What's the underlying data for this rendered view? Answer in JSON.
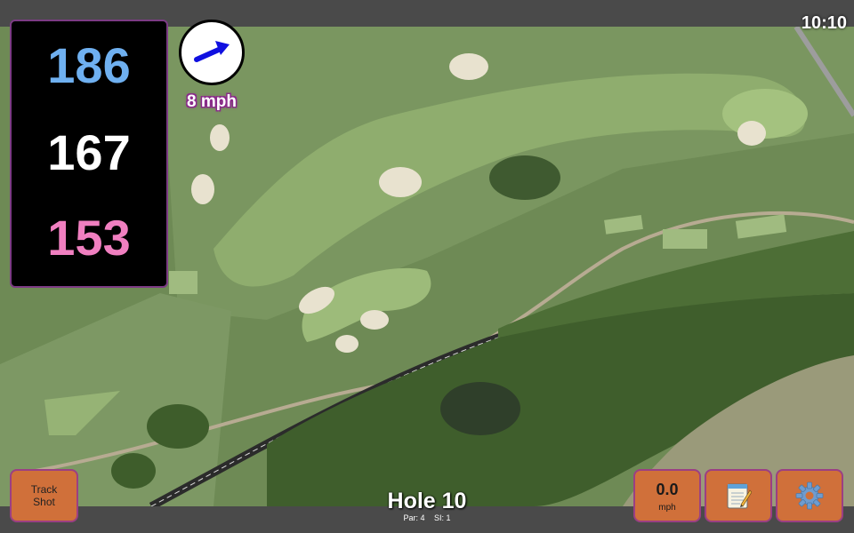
{
  "status_bar": {
    "time": "10:10"
  },
  "distances": {
    "back": "186",
    "middle": "167",
    "front": "153"
  },
  "wind": {
    "speed": "8 mph",
    "direction_icon": "arrow-right-up-icon"
  },
  "buttons": {
    "track_shot_line1": "Track",
    "track_shot_line2": "Shot",
    "speed_value": "0.0",
    "speed_unit": "mph",
    "notes_icon": "notepad-icon",
    "settings_icon": "gear-icon"
  },
  "hole": {
    "title": "Hole 10",
    "par": "Par: 4",
    "si": "SI: 1"
  },
  "colors": {
    "back_distance": "#6fb0f0",
    "middle_distance": "#ffffff",
    "front_distance": "#f07fc0",
    "button_bg": "#d0703a",
    "button_border": "#9b3f83",
    "wind_arrow": "#1010e0"
  }
}
